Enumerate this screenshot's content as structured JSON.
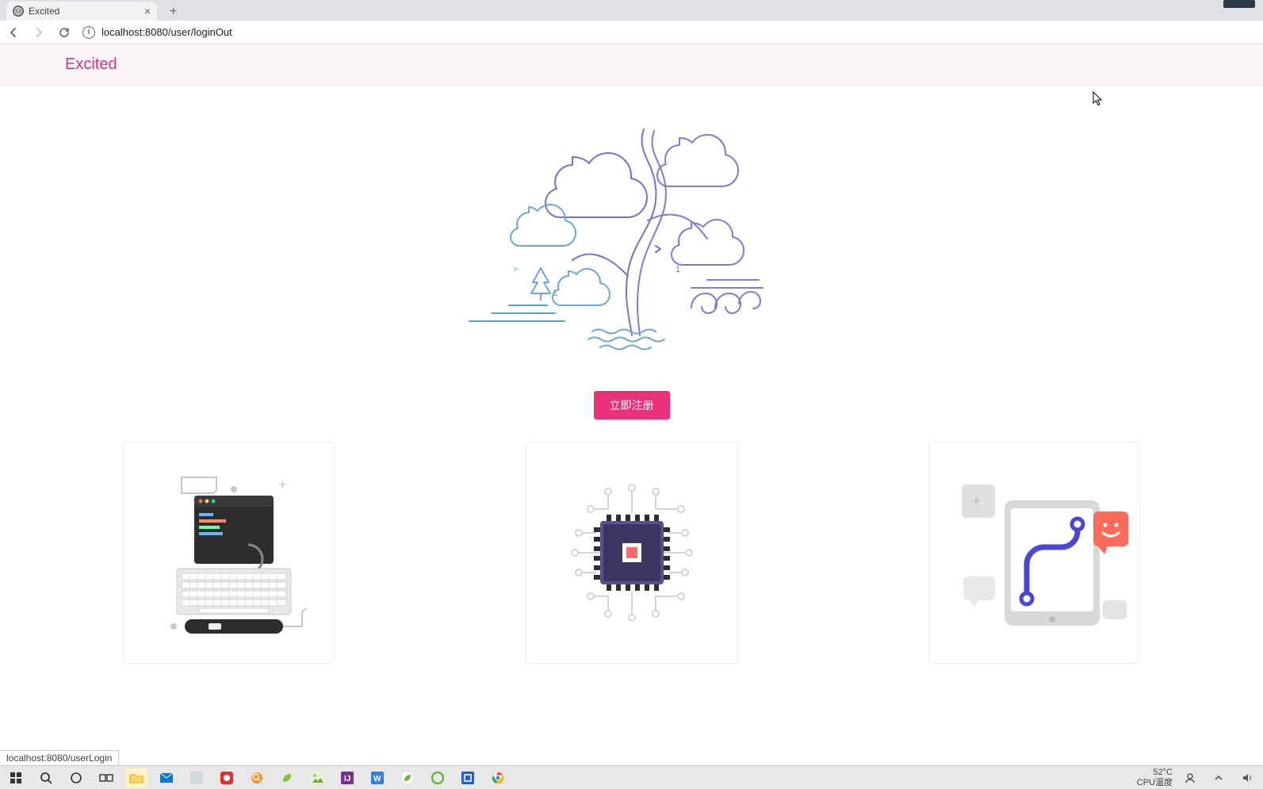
{
  "browser": {
    "tab_title": "Excited",
    "url": "localhost:8080/user/loginOut",
    "status_link": "localhost:8080/userLogin"
  },
  "page": {
    "brand": "Excited",
    "register_button": "立即注册"
  },
  "taskbar": {
    "temperature": "52°C",
    "cpu_label": "CPU温度"
  }
}
